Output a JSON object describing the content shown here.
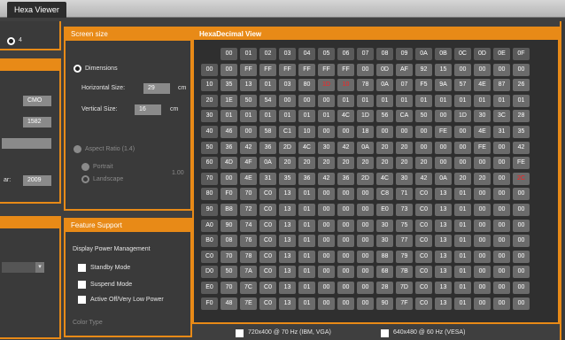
{
  "window": {
    "tab_label": "Hexa Viewer"
  },
  "left_panel": {
    "top_value": "4",
    "fields": [
      "CMO",
      "1582",
      "",
      "2009"
    ],
    "field_label_4": "ar:"
  },
  "screen_size": {
    "title": "Screen size",
    "dimensions_label": "Dimensions",
    "horizontal_label": "Horizontal Size:",
    "horizontal_value": "29",
    "vertical_label": "Vertical Size:",
    "vertical_value": "16",
    "unit": "cm",
    "aspect_label": "Aspect Ratio (1.4)",
    "portrait_label": "Portrait",
    "landscape_label": "Landscape",
    "ratio_value": "1.00"
  },
  "feature_support": {
    "title": "Feature Support",
    "dpm_label": "Display Power Management",
    "standby_label": "Standby Mode",
    "suspend_label": "Suspend Mode",
    "active_off_label": "Active Off/Very Low Power",
    "color_type_label": "Color Type"
  },
  "bottom_options": {
    "option1": "720x400 @ 70 Hz (IBM, VGA)",
    "option2": "640x480 @ 60 Hz (VESA)"
  },
  "hex_view": {
    "title": "HexaDecimal View",
    "col_headers": [
      "00",
      "01",
      "02",
      "03",
      "04",
      "05",
      "06",
      "07",
      "08",
      "09",
      "0A",
      "0B",
      "0C",
      "0D",
      "0E",
      "0F"
    ],
    "row_headers": [
      "00",
      "10",
      "20",
      "30",
      "40",
      "50",
      "60",
      "70",
      "80",
      "90",
      "A0",
      "B0",
      "C0",
      "D0",
      "E0",
      "F0"
    ],
    "rows": [
      [
        "00",
        "FF",
        "FF",
        "FF",
        "FF",
        "FF",
        "FF",
        "00",
        "0D",
        "AF",
        "92",
        "15",
        "00",
        "00",
        "00",
        "00"
      ],
      [
        "35",
        "13",
        "01",
        "03",
        "80",
        "1D",
        "10",
        "78",
        "0A",
        "07",
        "F5",
        "9A",
        "57",
        "4E",
        "87",
        "26"
      ],
      [
        "1E",
        "50",
        "54",
        "00",
        "00",
        "00",
        "01",
        "01",
        "01",
        "01",
        "01",
        "01",
        "01",
        "01",
        "01",
        "01"
      ],
      [
        "01",
        "01",
        "01",
        "01",
        "01",
        "01",
        "4C",
        "1D",
        "56",
        "CA",
        "50",
        "00",
        "1D",
        "30",
        "3C",
        "28"
      ],
      [
        "46",
        "00",
        "58",
        "C1",
        "10",
        "00",
        "00",
        "18",
        "00",
        "00",
        "00",
        "FE",
        "00",
        "4E",
        "31",
        "35"
      ],
      [
        "36",
        "42",
        "36",
        "2D",
        "4C",
        "30",
        "42",
        "0A",
        "20",
        "20",
        "00",
        "00",
        "00",
        "FE",
        "00",
        "42"
      ],
      [
        "4D",
        "4F",
        "0A",
        "20",
        "20",
        "20",
        "20",
        "20",
        "20",
        "20",
        "20",
        "00",
        "00",
        "00",
        "00",
        "FE"
      ],
      [
        "00",
        "4E",
        "31",
        "35",
        "36",
        "42",
        "36",
        "2D",
        "4C",
        "30",
        "42",
        "0A",
        "20",
        "20",
        "00",
        "2C"
      ],
      [
        "F0",
        "70",
        "C0",
        "13",
        "01",
        "00",
        "00",
        "00",
        "C8",
        "71",
        "C0",
        "13",
        "01",
        "00",
        "00",
        "00"
      ],
      [
        "B8",
        "72",
        "C0",
        "13",
        "01",
        "00",
        "00",
        "00",
        "E0",
        "73",
        "C0",
        "13",
        "01",
        "00",
        "00",
        "00"
      ],
      [
        "90",
        "74",
        "C0",
        "13",
        "01",
        "00",
        "00",
        "00",
        "30",
        "75",
        "C0",
        "13",
        "01",
        "00",
        "00",
        "00"
      ],
      [
        "08",
        "76",
        "C0",
        "13",
        "01",
        "00",
        "00",
        "00",
        "30",
        "77",
        "C0",
        "13",
        "01",
        "00",
        "00",
        "00"
      ],
      [
        "70",
        "78",
        "C0",
        "13",
        "01",
        "00",
        "00",
        "00",
        "88",
        "79",
        "C0",
        "13",
        "01",
        "00",
        "00",
        "00"
      ],
      [
        "50",
        "7A",
        "C0",
        "13",
        "01",
        "00",
        "00",
        "00",
        "68",
        "7B",
        "C0",
        "13",
        "01",
        "00",
        "00",
        "00"
      ],
      [
        "70",
        "7C",
        "C0",
        "13",
        "01",
        "00",
        "00",
        "00",
        "28",
        "7D",
        "C0",
        "13",
        "01",
        "00",
        "00",
        "00"
      ],
      [
        "48",
        "7E",
        "C0",
        "13",
        "01",
        "00",
        "00",
        "00",
        "90",
        "7F",
        "C0",
        "13",
        "01",
        "00",
        "00",
        "00"
      ]
    ],
    "highlight_color": "#ff2020",
    "highlighted": [
      [
        1,
        5
      ],
      [
        1,
        6
      ],
      [
        7,
        15
      ]
    ]
  },
  "colors": {
    "accent": "#e88a17",
    "panel": "#3a3a3a",
    "cell": "#6b6b6b"
  }
}
